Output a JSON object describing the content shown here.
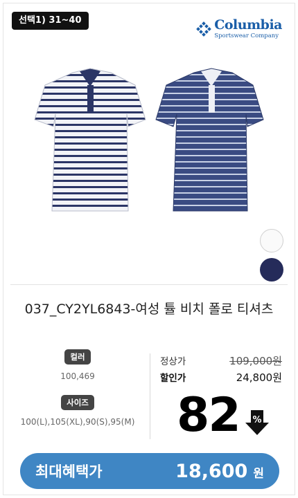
{
  "badge": "선택1) 31~40",
  "brand": {
    "name": "Columbia",
    "sub": "Sportswear Company",
    "color": "#1a5ea8"
  },
  "product": {
    "image_icon": "striped-polo-shirts",
    "title": "037_CY2YL6843-여성 튤 비치 폴로 티셔츠"
  },
  "swatches": [
    {
      "name": "white",
      "color": "#fafafa"
    },
    {
      "name": "navy",
      "color": "#252b5a"
    }
  ],
  "options": {
    "color_label": "컬러",
    "color_value": "100,469",
    "size_label": "사이즈",
    "size_value": "100(L),105(XL),90(S),95(M)"
  },
  "prices": {
    "regular_label": "정상가",
    "regular_value": "109,000원",
    "sale_label": "할인가",
    "sale_value": "24,800원"
  },
  "discount": {
    "value": "82",
    "icon": "percent-down-arrow-icon"
  },
  "max_benefit": {
    "label": "최대혜택가",
    "amount": "18,600",
    "unit": "원",
    "color": "#3f86c4"
  }
}
